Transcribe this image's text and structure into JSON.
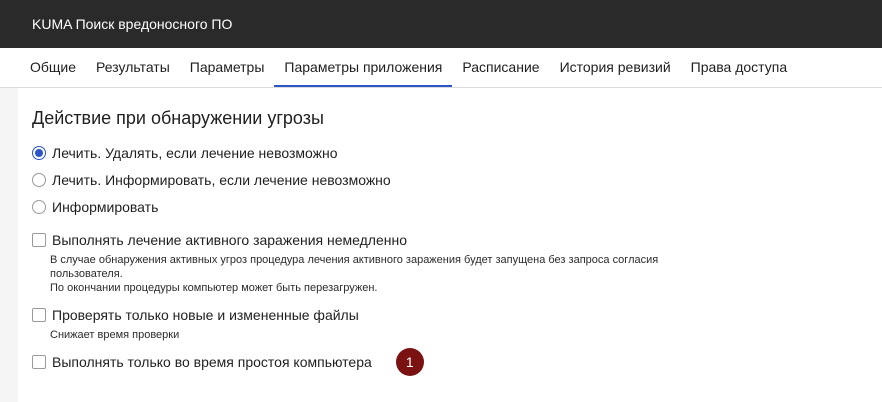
{
  "window": {
    "title": "KUMA Поиск вредоносного ПО"
  },
  "tabs": [
    {
      "label": "Общие"
    },
    {
      "label": "Результаты"
    },
    {
      "label": "Параметры"
    },
    {
      "label": "Параметры приложения",
      "active": true
    },
    {
      "label": "Расписание"
    },
    {
      "label": "История ревизий"
    },
    {
      "label": "Права доступа"
    }
  ],
  "section": {
    "title": "Действие при обнаружении угрозы",
    "radios": [
      {
        "label": "Лечить. Удалять, если лечение невозможно",
        "checked": true
      },
      {
        "label": "Лечить. Информировать, если лечение невозможно",
        "checked": false
      },
      {
        "label": "Информировать",
        "checked": false
      }
    ],
    "checkboxes": [
      {
        "label": "Выполнять лечение активного заражения немедленно",
        "checked": false,
        "hint_lines": [
          "В случае обнаружения активных угроз процедура лечения активного заражения будет запущена без запроса согласия",
          "пользователя.",
          "По окончании процедуры компьютер может быть перезагружен."
        ]
      },
      {
        "label": "Проверять только новые и измененные файлы",
        "checked": false,
        "hint_lines": [
          "Снижает время проверки"
        ]
      },
      {
        "label": "Выполнять только во время простоя компьютера",
        "checked": false,
        "badge": "1"
      }
    ]
  },
  "colors": {
    "titlebar": "#2a2a2a",
    "accent": "#2b55c8",
    "badge": "#7a1212"
  }
}
